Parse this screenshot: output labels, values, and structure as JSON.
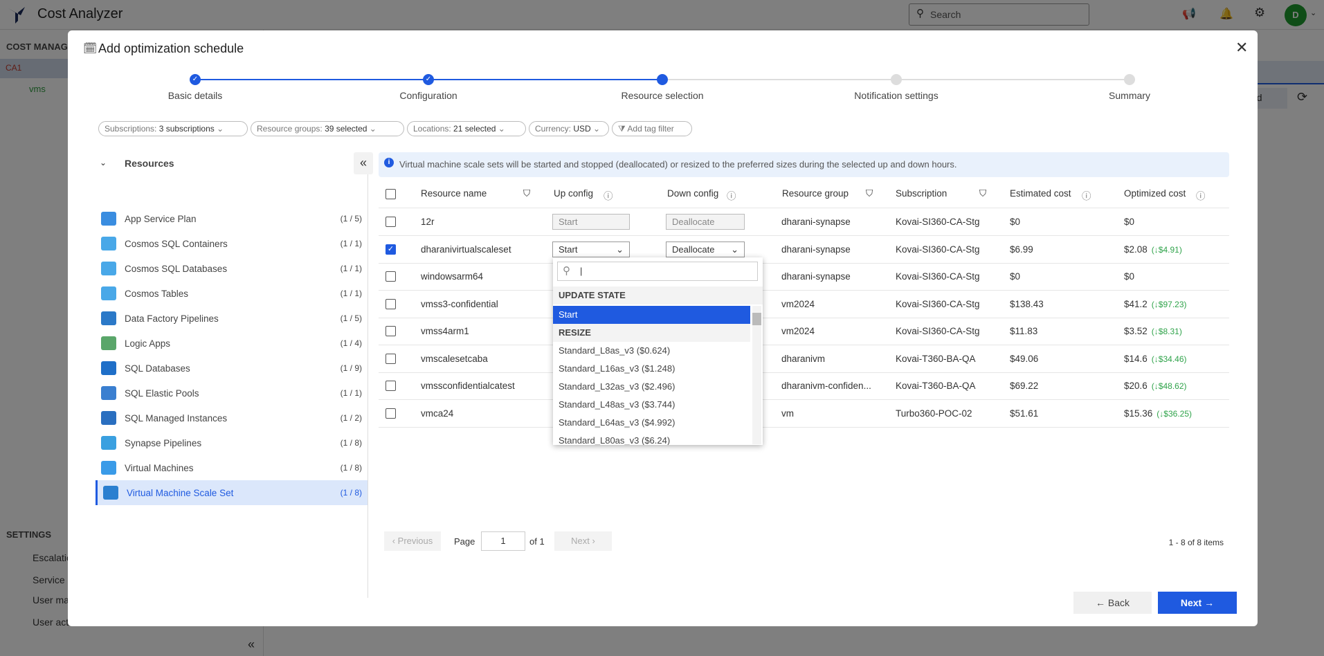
{
  "app": {
    "title": "Cost Analyzer",
    "search_placeholder": "Search",
    "avatar": "D"
  },
  "sidebar": {
    "section": "COST MANAGE",
    "tree": [
      {
        "label": "CA1",
        "color": "#c0392b"
      },
      {
        "label": "vms",
        "color": "#2e9b3e"
      }
    ],
    "settings_title": "SETTINGS",
    "settings": [
      "Escalatio",
      "Service p",
      "User ma",
      "User act"
    ]
  },
  "background": {
    "add_label": "dd"
  },
  "modal": {
    "title": "Add optimization schedule",
    "steps": [
      {
        "label": "Basic details",
        "state": "done"
      },
      {
        "label": "Configuration",
        "state": "done"
      },
      {
        "label": "Resource selection",
        "state": "current"
      },
      {
        "label": "Notification settings",
        "state": "pending"
      },
      {
        "label": "Summary",
        "state": "pending"
      }
    ],
    "filters": [
      {
        "k": "Subscriptions: ",
        "v": "3 subscriptions"
      },
      {
        "k": "Resource groups: ",
        "v": "39 selected"
      },
      {
        "k": "Locations: ",
        "v": "21 selected"
      },
      {
        "k": "Currency: ",
        "v": "USD"
      }
    ],
    "add_tag_filter": "Add tag filter",
    "resources_title": "Resources",
    "resources": [
      {
        "label": "App Service Plan",
        "count": "(1 / 5)",
        "color": "#3a8de0"
      },
      {
        "label": "Cosmos SQL Containers",
        "count": "(1 / 1)",
        "color": "#49a8e8"
      },
      {
        "label": "Cosmos SQL Databases",
        "count": "(1 / 1)",
        "color": "#49a8e8"
      },
      {
        "label": "Cosmos Tables",
        "count": "(1 / 1)",
        "color": "#49a8e8"
      },
      {
        "label": "Data Factory Pipelines",
        "count": "(1 / 5)",
        "color": "#2b79c8"
      },
      {
        "label": "Logic Apps",
        "count": "(1 / 4)",
        "color": "#5aa66a"
      },
      {
        "label": "SQL Databases",
        "count": "(1 / 9)",
        "color": "#1f6fc8"
      },
      {
        "label": "SQL Elastic Pools",
        "count": "(1 / 1)",
        "color": "#3a7fd0"
      },
      {
        "label": "SQL Managed Instances",
        "count": "(1 / 2)",
        "color": "#2a6fc0"
      },
      {
        "label": "Synapse Pipelines",
        "count": "(1 / 8)",
        "color": "#3aa0e0"
      },
      {
        "label": "Virtual Machines",
        "count": "(1 / 8)",
        "color": "#3a9be8"
      },
      {
        "label": "Virtual Machine Scale Set",
        "count": "(1 / 8)",
        "color": "#2a7fd0",
        "active": true
      }
    ],
    "info": "Virtual machine scale sets will be started and stopped (deallocated) or resized to the preferred sizes during the selected up and down hours.",
    "columns": [
      "Resource name",
      "Up config",
      "Down config",
      "Resource group",
      "Subscription",
      "Estimated cost",
      "Optimized cost"
    ],
    "rows": [
      {
        "name": "12r",
        "up": "Start",
        "down": "Deallocate",
        "rg": "dharani-synapse",
        "sub": "Kovai-SI360-CA-Stg",
        "est": "$0",
        "opt": "$0",
        "save": "",
        "checked": false,
        "editable": false
      },
      {
        "name": "dharanivirtualscaleset",
        "up": "Start",
        "down": "Deallocate",
        "rg": "dharani-synapse",
        "sub": "Kovai-SI360-CA-Stg",
        "est": "$6.99",
        "opt": "$2.08",
        "save": "(↓$4.91)",
        "checked": true,
        "editable": true
      },
      {
        "name": "windowsarm64",
        "up": "",
        "down": "",
        "rg": "dharani-synapse",
        "sub": "Kovai-SI360-CA-Stg",
        "est": "$0",
        "opt": "$0",
        "save": "",
        "checked": false
      },
      {
        "name": "vmss3-confidential",
        "up": "",
        "down": "",
        "rg": "vm2024",
        "sub": "Kovai-SI360-CA-Stg",
        "est": "$138.43",
        "opt": "$41.2",
        "save": "(↓$97.23)",
        "checked": false
      },
      {
        "name": "vmss4arm1",
        "up": "",
        "down": "",
        "rg": "vm2024",
        "sub": "Kovai-SI360-CA-Stg",
        "est": "$11.83",
        "opt": "$3.52",
        "save": "(↓$8.31)",
        "checked": false
      },
      {
        "name": "vmscalesetcaba",
        "up": "",
        "down": "",
        "rg": "dharanivm",
        "sub": "Kovai-T360-BA-QA",
        "est": "$49.06",
        "opt": "$14.6",
        "save": "(↓$34.46)",
        "checked": false
      },
      {
        "name": "vmssconfidentialcatest",
        "up": "",
        "down": "",
        "rg": "dharanivm-confiden...",
        "sub": "Kovai-T360-BA-QA",
        "est": "$69.22",
        "opt": "$20.6",
        "save": "(↓$48.62)",
        "checked": false
      },
      {
        "name": "vmca24",
        "up": "",
        "down": "",
        "rg": "vm",
        "sub": "Turbo360-POC-02",
        "est": "$51.61",
        "opt": "$15.36",
        "save": "(↓$36.25)",
        "checked": false
      }
    ],
    "dropdown": {
      "search_value": "",
      "group1": "UPDATE STATE",
      "selected": "Start",
      "group2": "RESIZE",
      "options": [
        "Standard_L8as_v3 ($0.624)",
        "Standard_L16as_v3 ($1.248)",
        "Standard_L32as_v3 ($2.496)",
        "Standard_L48as_v3 ($3.744)",
        "Standard_L64as_v3 ($4.992)",
        "Standard_L80as_v3 ($6.24)"
      ]
    },
    "pagination": {
      "previous": "‹ Previous",
      "page_label": "Page",
      "page": "1",
      "of": "of 1",
      "next": "Next ›",
      "summary": "1 - 8 of 8 items"
    },
    "back": "← Back",
    "next": "Next →"
  },
  "colors": {
    "accent": "#1f5ae0",
    "savings": "#2fa34a"
  }
}
